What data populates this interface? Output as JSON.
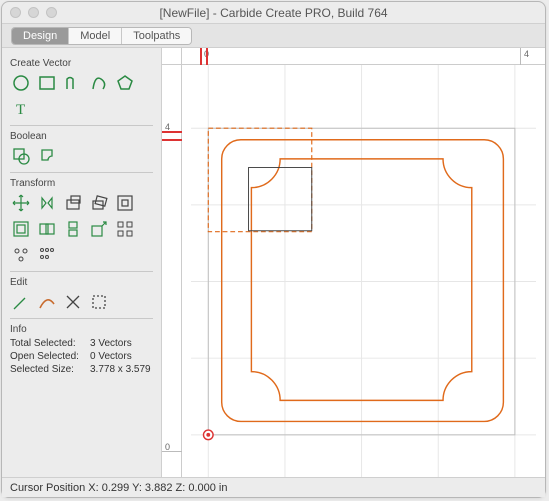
{
  "window": {
    "title": "[NewFile] - Carbide Create PRO, Build 764"
  },
  "tabs": {
    "design": "Design",
    "model": "Model",
    "toolpaths": "Toolpaths"
  },
  "sections": {
    "create_vector": "Create Vector",
    "boolean": "Boolean",
    "transform": "Transform",
    "edit": "Edit",
    "info": "Info"
  },
  "tools": {
    "create": {
      "circle": "circle",
      "rect": "rectangle",
      "poly": "polyline",
      "curve": "curve",
      "polygon": "polygon",
      "text": "text"
    },
    "boolean": {
      "union": "union",
      "subtract": "subtract"
    },
    "transform": {
      "move": "move",
      "mirror": "mirror",
      "box": "scale-box",
      "rotate": "rotate",
      "align": "align",
      "offset": "offset",
      "group": "group",
      "flip_h": "flip-h",
      "resize": "resize",
      "array": "array",
      "pattern_a": "pattern-circular",
      "pattern_b": "pattern-linear"
    },
    "edit": {
      "node": "node-edit",
      "trim": "trim",
      "break": "break",
      "join": "join"
    }
  },
  "info": {
    "total_selected_label": "Total Selected:",
    "total_selected_value": "3 Vectors",
    "open_selected_label": "Open Selected:",
    "open_selected_value": "0 Vectors",
    "selected_size_label": "Selected Size:",
    "selected_size_value": "3.778 x 3.579"
  },
  "ruler": {
    "h0": "0",
    "h4": "4",
    "v0": "0",
    "v4": "4"
  },
  "status": {
    "text": "Cursor Position X: 0.299 Y: 3.882 Z: 0.000 in"
  }
}
